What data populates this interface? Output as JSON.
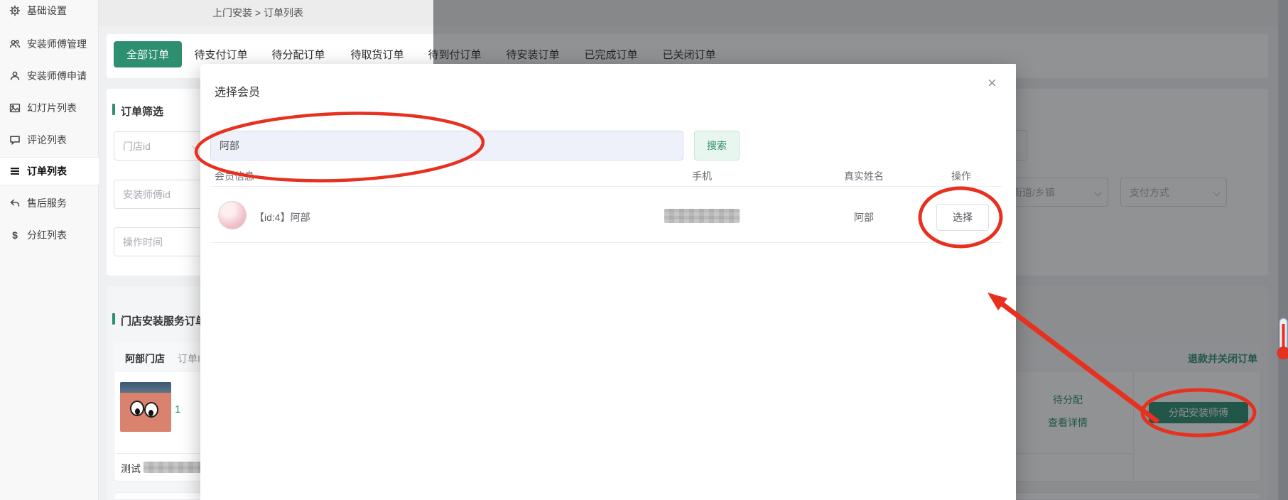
{
  "app": {
    "breadcrumb": "上门安装 > 订单列表"
  },
  "sidebar": {
    "items": [
      {
        "label": "基础设置"
      },
      {
        "label": "安装师傅管理"
      },
      {
        "label": "安装师傅申请"
      },
      {
        "label": "幻灯片列表"
      },
      {
        "label": "评论列表"
      },
      {
        "label": "订单列表"
      },
      {
        "label": "售后服务"
      },
      {
        "label": "分红列表"
      }
    ],
    "active_item": "订单列表"
  },
  "tabs": {
    "active": "全部订单",
    "items": [
      {
        "label": "全部订单"
      },
      {
        "label": "待支付订单"
      },
      {
        "label": "待分配订单"
      },
      {
        "label": "待取货订单"
      },
      {
        "label": "待到付订单"
      },
      {
        "label": "待安装订单"
      },
      {
        "label": "已完成订单"
      },
      {
        "label": "已关闭订单"
      }
    ]
  },
  "filter_panel": {
    "title": "订单筛选",
    "store_id_placeholder": "门店id",
    "installer_id_placeholder": "安装师傅id",
    "operation_time_placeholder": "操作时间",
    "street_placeholder": "街道/乡镇",
    "payment_placeholder": "支付方式"
  },
  "orders_panel": {
    "title": "门店安装服务订单",
    "store_name": "阿部门店",
    "order_id_label": "订单ID",
    "item_count": "1",
    "row_label": "测试",
    "refund_close": "退款并关闭订单",
    "status": "待分配",
    "view_detail": "查看详情",
    "assign_button": "分配安装师傅"
  },
  "modal": {
    "title": "选择会员",
    "close_glyph": "×",
    "search_value": "阿部",
    "search_button": "搜索",
    "columns": {
      "member": "会员信息",
      "phone": "手机",
      "real_name": "真实姓名",
      "action": "操作"
    },
    "row": {
      "member_name": "【id:4】阿部",
      "real_name": "阿部",
      "select_button": "选择"
    }
  },
  "colors": {
    "primary_green": "#2e8f70",
    "annotation_red": "#e8301f"
  }
}
